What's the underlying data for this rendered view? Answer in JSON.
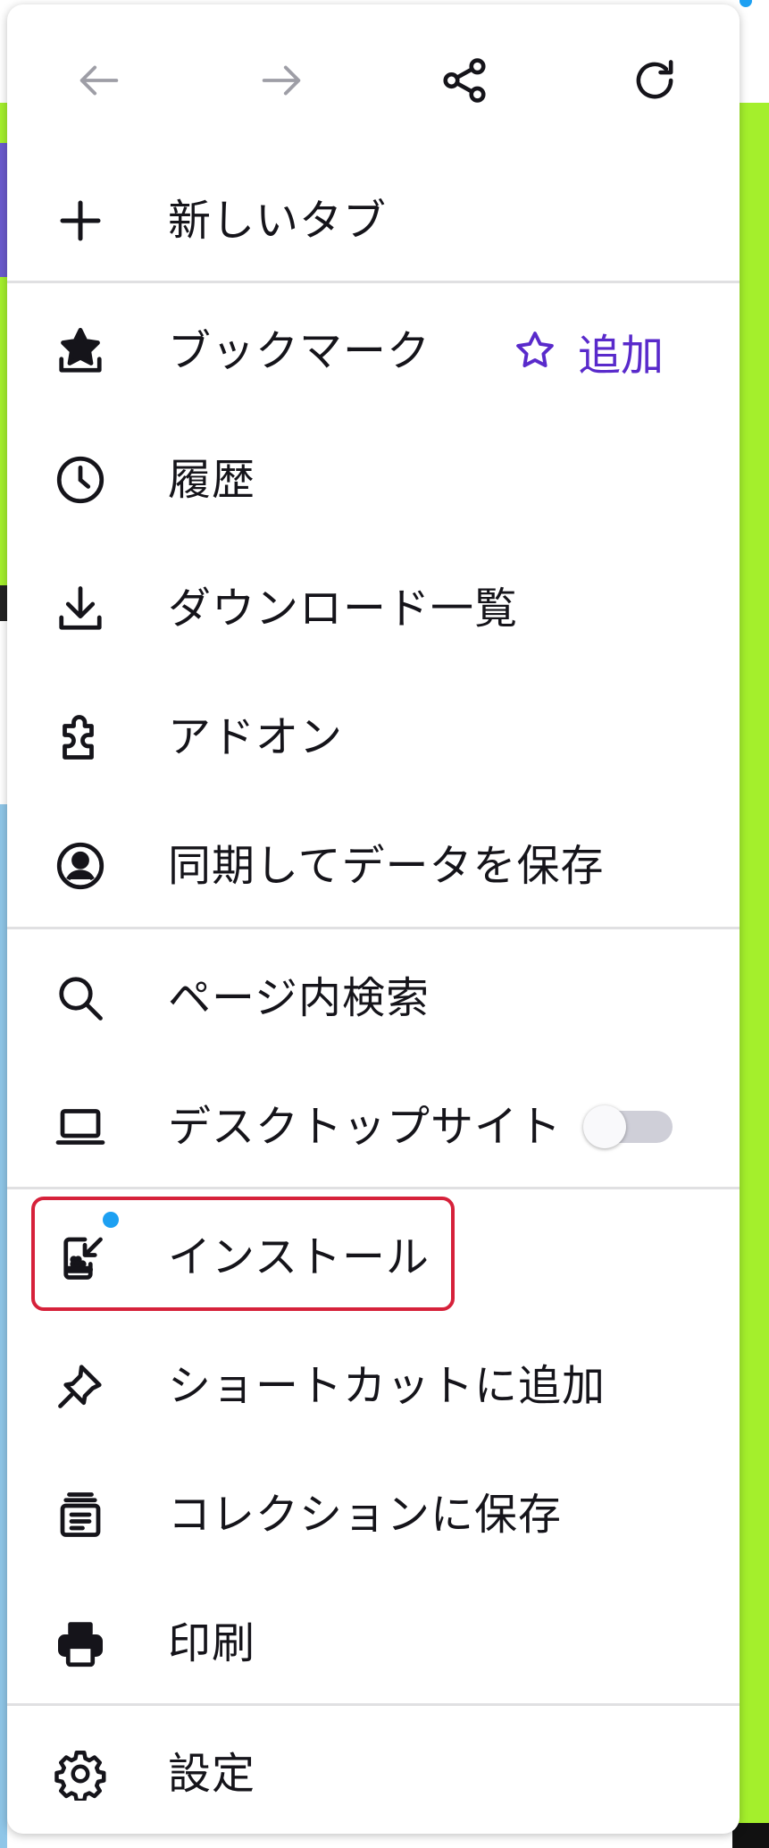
{
  "toolbar": {
    "back": "arrow-left-icon",
    "forward": "arrow-right-icon",
    "share": "share-icon",
    "reload": "reload-icon"
  },
  "menu": {
    "new_tab": "新しいタブ",
    "bookmarks": "ブックマーク",
    "bookmark_add": "追加",
    "history": "履歴",
    "downloads": "ダウンロード一覧",
    "addons": "アドオン",
    "sync": "同期してデータを保存",
    "find_in_page": "ページ内検索",
    "desktop_site": "デスクトップサイト",
    "install": "インストール",
    "add_shortcut": "ショートカットに追加",
    "save_collection": "コレクションに保存",
    "print": "印刷",
    "settings": "設定"
  },
  "state": {
    "desktop_site_enabled": false
  },
  "colors": {
    "accent": "#592acb",
    "highlight": "#d6213a",
    "notification_dot": "#1da0f2",
    "page_green": "#a4ef2c"
  }
}
